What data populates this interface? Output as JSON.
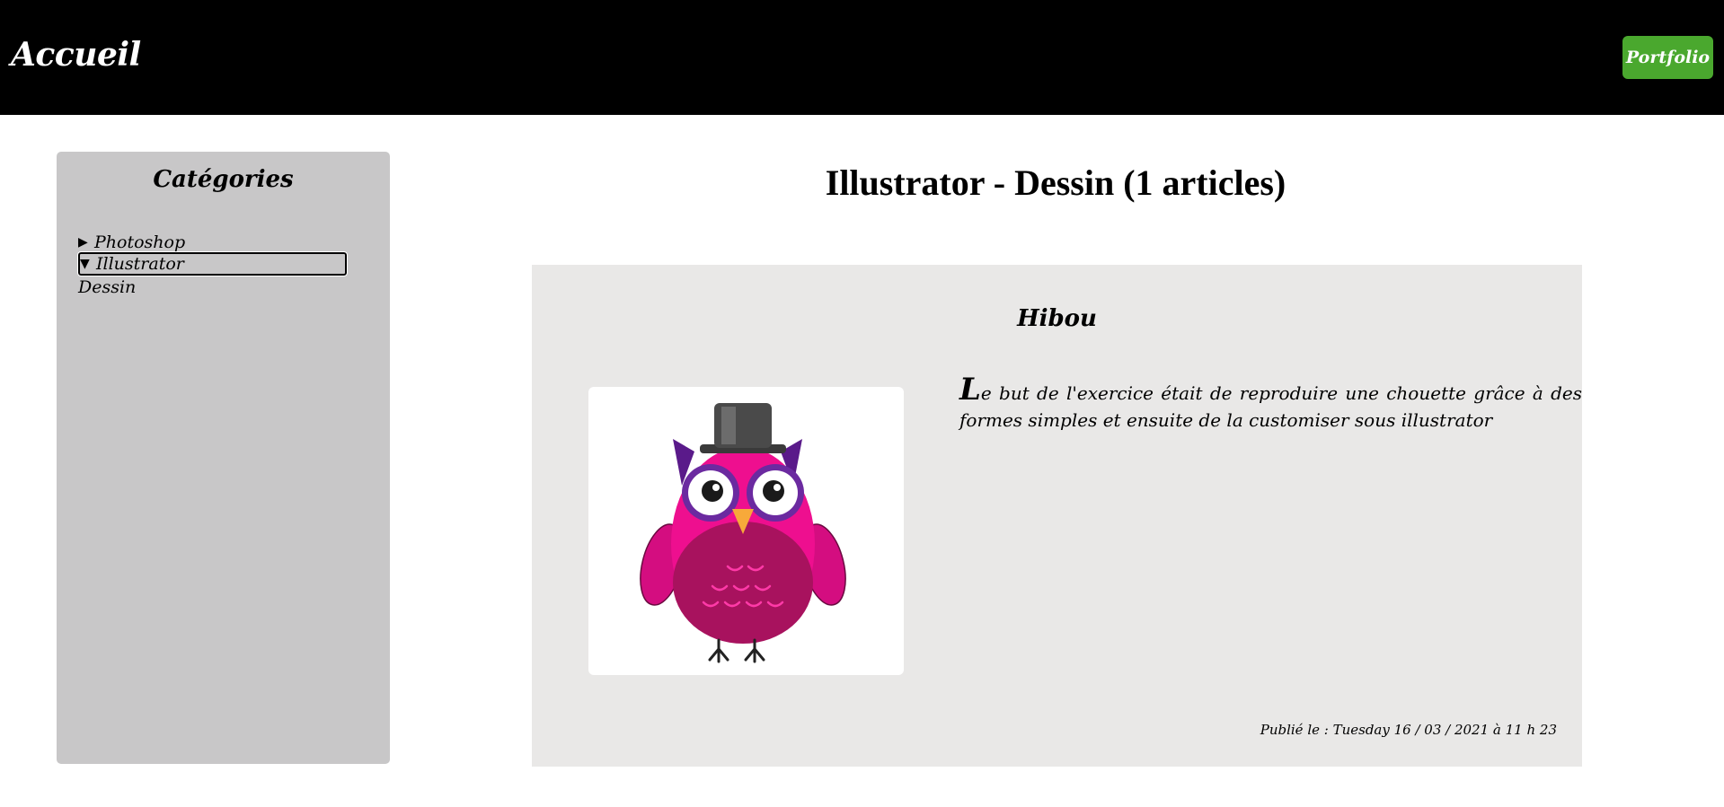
{
  "header": {
    "brand": "Accueil",
    "portfolio_label": "Portfolio"
  },
  "sidebar": {
    "title": "Catégories",
    "items": [
      {
        "marker": "▶",
        "label": "Photoshop"
      },
      {
        "marker": "▼",
        "label": "Illustrator"
      },
      {
        "marker": "",
        "label": "Dessin"
      }
    ]
  },
  "main": {
    "heading": "Illustrator - Dessin (1 articles)",
    "article": {
      "title": "Hibou",
      "dropcap": "L",
      "body": "e but de l'exercice était de reproduire une chouette grâce à des formes simples et ensuite de la customiser sous illustrator",
      "published": "Publié le : Tuesday 16 / 03 / 2021 à 11 h 23"
    }
  },
  "colors": {
    "header_bg": "#000000",
    "portfolio_btn": "#4aa82e",
    "sidebar_bg": "#c8c7c8",
    "article_bg": "#e9e8e7",
    "owl_body": "#ee0f8f",
    "owl_belly": "#a8125e"
  },
  "icons": {
    "collapsed": "triangle-right-icon",
    "expanded": "triangle-down-icon"
  }
}
